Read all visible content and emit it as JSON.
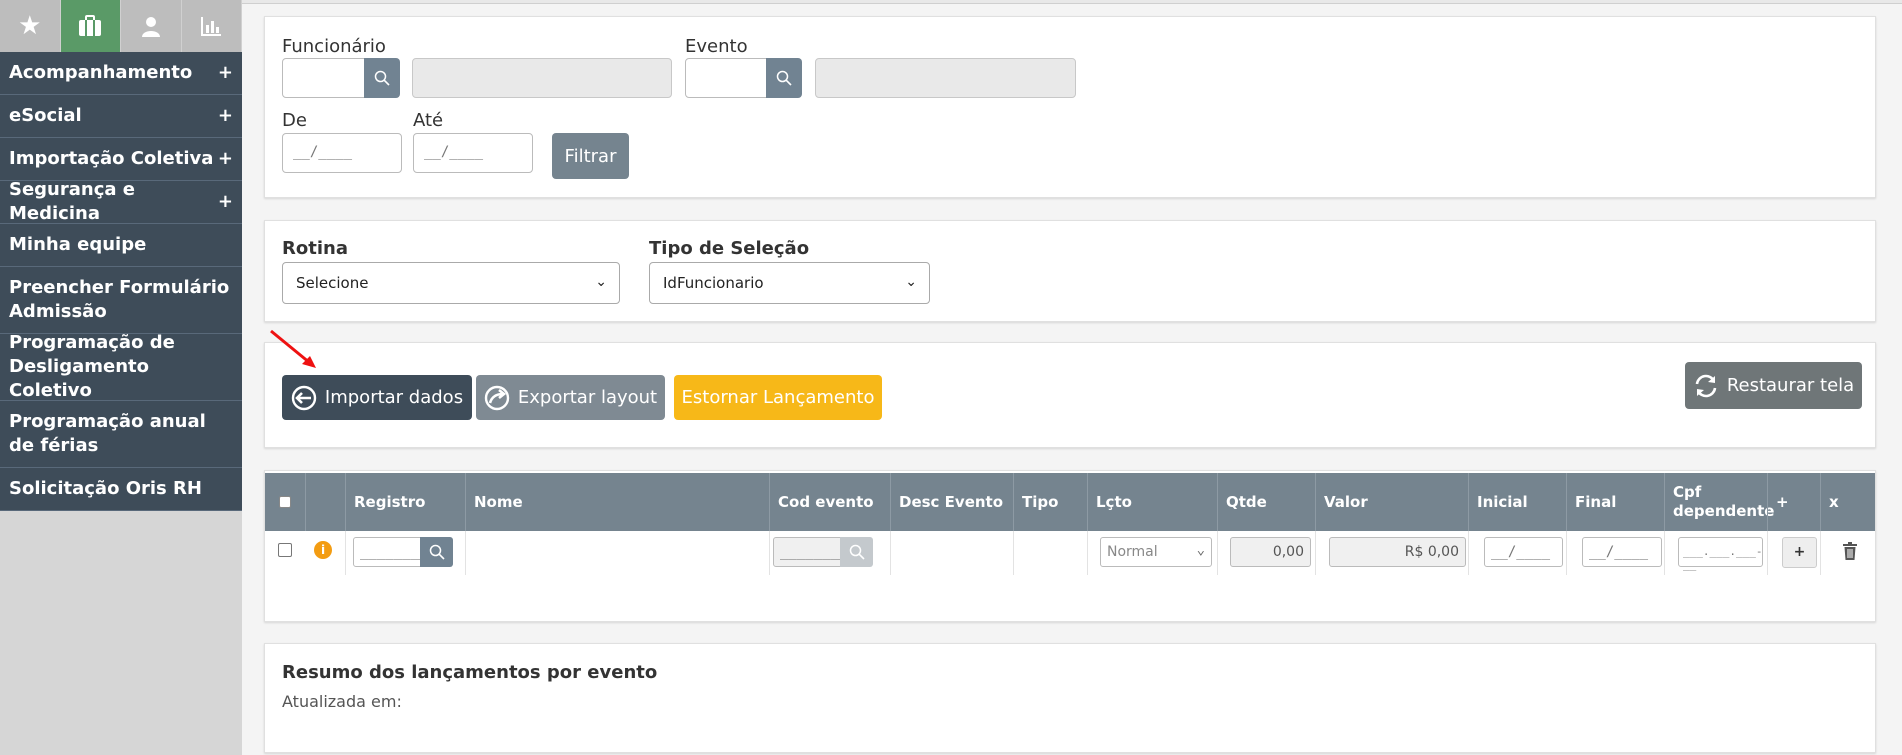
{
  "sidebar": {
    "tabs": [
      {
        "icon": "star-icon",
        "glyph": "★"
      },
      {
        "icon": "briefcase-icon",
        "glyph": "▣"
      },
      {
        "icon": "user-icon",
        "glyph": "●"
      },
      {
        "icon": "bar-chart-icon",
        "glyph": "▥"
      }
    ],
    "items": [
      {
        "label": "Acompanhamento",
        "expand": "+"
      },
      {
        "label": "eSocial",
        "expand": "+"
      },
      {
        "label": "Importação Coletiva",
        "expand": "+"
      },
      {
        "label": "Segurança e Medicina",
        "expand": "+"
      },
      {
        "label": "Minha equipe",
        "expand": ""
      },
      {
        "label": "Preencher Formulário Admissão",
        "expand": ""
      },
      {
        "label": "Programação de Desligamento Coletivo",
        "expand": ""
      },
      {
        "label": "Programação anual de férias",
        "expand": ""
      },
      {
        "label": "Solicitação Oris RH",
        "expand": ""
      }
    ]
  },
  "filters": {
    "funcionario_label": "Funcionário",
    "evento_label": "Evento",
    "de_label": "De",
    "ate_label": "Até",
    "date_mask": "__/____",
    "filtrar_label": "Filtrar"
  },
  "selection": {
    "rotina_label": "Rotina",
    "rotina_value": "Selecione",
    "tipo_label": "Tipo de Seleção",
    "tipo_value": "IdFuncionario"
  },
  "actions": {
    "importar": "Importar dados",
    "exportar": "Exportar layout",
    "estornar": "Estornar Lançamento",
    "restaurar": "Restaurar tela"
  },
  "table": {
    "headers": [
      "Registro",
      "Nome",
      "Cod evento",
      "Desc Evento",
      "Tipo",
      "Lçto",
      "Qtde",
      "Valor",
      "Inicial",
      "Final",
      "Cpf dependente",
      "+",
      "x"
    ],
    "row": {
      "registro_mask": "________",
      "cod_mask": "________",
      "lcto": "Normal",
      "qtde": "0,00",
      "valor": "R$ 0,00",
      "inicial": "__/____",
      "final": "__/____",
      "cpf": "___.___.___-__",
      "add": "+"
    }
  },
  "summary": {
    "title": "Resumo dos lançamentos por evento",
    "updated": "Atualizada em:"
  },
  "colors": {
    "sidebar_bg": "#3e4c59",
    "accent_green": "#5a9a67",
    "importar": "#3e4c59",
    "exportar": "#7f8a93",
    "estornar": "#f7b818",
    "restaurar": "#6f7678",
    "table_header": "#75848f"
  }
}
